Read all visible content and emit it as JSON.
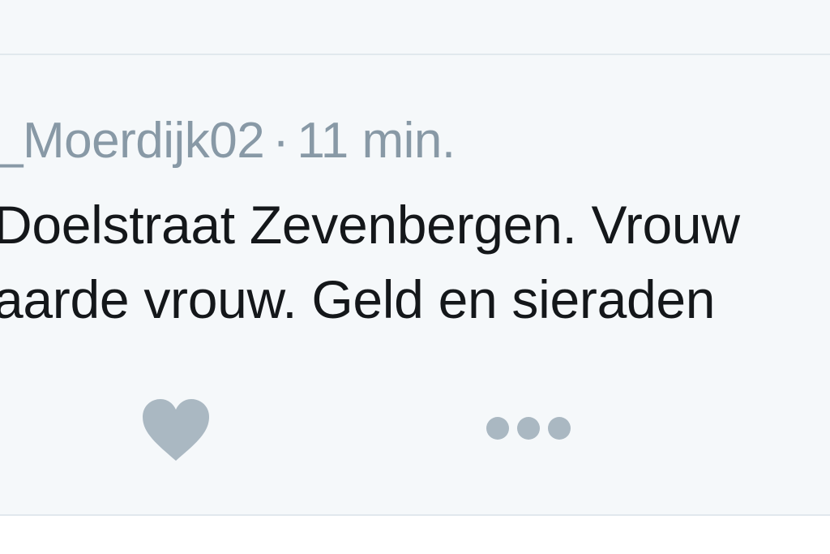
{
  "tweet": {
    "username": "_Moerdijk02",
    "separator": "·",
    "time": "11 min.",
    "text_line_1": "Doelstraat Zevenbergen. Vrouw",
    "text_line_2": "aarde vrouw. Geld en sieraden",
    "actions": {
      "like_icon": "heart-icon",
      "more_icon": "more-dots-icon"
    }
  },
  "colors": {
    "background": "#f5f8fa",
    "divider": "#e1e8ed",
    "meta_text": "#8899a6",
    "body_text": "#14171a",
    "icon": "#aab8c2"
  }
}
